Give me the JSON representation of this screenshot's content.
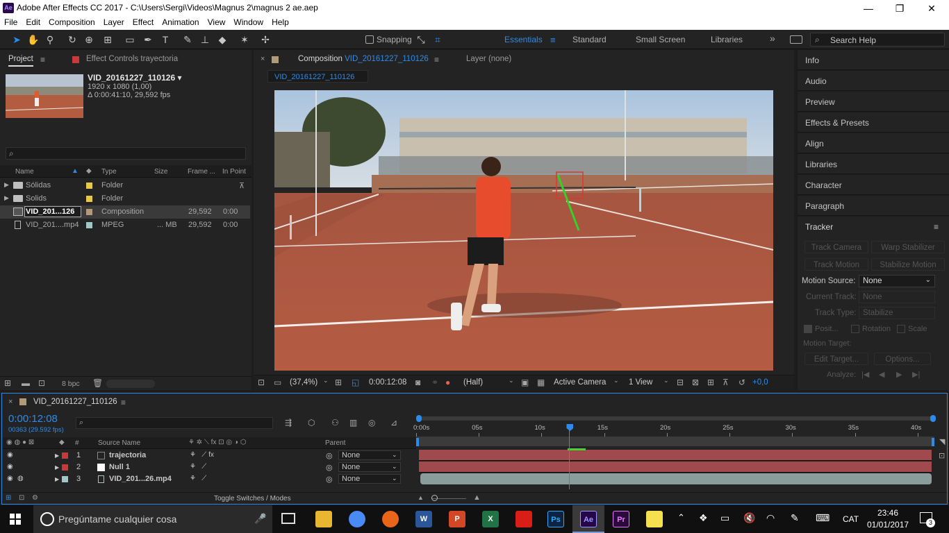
{
  "titlebar": {
    "app_icon": "Ae",
    "title": "Adobe After Effects CC 2017 - C:\\Users\\Sergi\\Videos\\Magnus 2\\magnus 2 ae.aep",
    "minimize": "—",
    "restore": "❐",
    "close": "✕"
  },
  "menu": [
    "File",
    "Edit",
    "Composition",
    "Layer",
    "Effect",
    "Animation",
    "View",
    "Window",
    "Help"
  ],
  "toolbar": {
    "snapping_label": "Snapping",
    "search_placeholder": "Search Help",
    "more": "»"
  },
  "workspaces": [
    "Essentials",
    "Standard",
    "Small Screen",
    "Libraries"
  ],
  "project_panel": {
    "tab_project": "Project",
    "tab_effect_controls": "Effect Controls trayectoria",
    "item_name": "VID_20161227_110126 ▾",
    "item_res": "1920 x 1080 (1,00)",
    "item_dur": "Δ 0:00:41:10, 29,592 fps",
    "search_placeholder": "",
    "columns": {
      "name": "Name",
      "type": "Type",
      "size": "Size",
      "frame": "Frame ...",
      "in_point": "In Point"
    },
    "rows": [
      {
        "name": "Sólidas",
        "type": "Folder",
        "size": "",
        "frame": "",
        "in_point": "",
        "color": "#e6c84a"
      },
      {
        "name": "Solids",
        "type": "Folder",
        "size": "",
        "frame": "",
        "in_point": "",
        "color": "#e6c84a"
      },
      {
        "name": "VID_201...126",
        "type": "Composition",
        "size": "",
        "frame": "29,592",
        "in_point": "0:00",
        "color": "#b09a78"
      },
      {
        "name": "VID_201....mp4",
        "type": "MPEG",
        "size": "... MB",
        "frame": "29,592",
        "in_point": "0:00",
        "color": "#9fc7c7"
      }
    ],
    "bpc": "8 bpc"
  },
  "composition": {
    "tab_prefix": "Composition",
    "tab_name": "VID_20161227_110126",
    "layer_tab": "Layer (none)",
    "subtab": "VID_20161227_110126",
    "zoom": "(37,4%)",
    "timecode": "0:00:12:08",
    "resolution": "(Half)",
    "camera": "Active Camera",
    "views": "1 View",
    "exposure": "+0,0"
  },
  "right_panels": [
    "Info",
    "Audio",
    "Preview",
    "Effects & Presets",
    "Align",
    "Libraries",
    "Character",
    "Paragraph"
  ],
  "tracker": {
    "title": "Tracker",
    "track_camera": "Track Camera",
    "warp_stabilizer": "Warp Stabilizer",
    "track_motion": "Track Motion",
    "stabilize_motion": "Stabilize Motion",
    "motion_source_label": "Motion Source:",
    "motion_source_value": "None",
    "current_track_label": "Current Track:",
    "current_track_value": "None",
    "track_type_label": "Track Type:",
    "track_type_value": "Stabilize",
    "position_label": "Posit...",
    "rotation_label": "Rotation",
    "scale_label": "Scale",
    "motion_target_label": "Motion Target:",
    "edit_target": "Edit Target...",
    "options": "Options...",
    "analyze_label": "Analyze:"
  },
  "timeline": {
    "comp_name": "VID_20161227_110126",
    "timecode": "0:00:12:08",
    "frame_info": "00363 (29.592 fps)",
    "search_placeholder": "",
    "col_num": "#",
    "col_source": "Source Name",
    "col_parent": "Parent",
    "layers": [
      {
        "num": "1",
        "name": "trajectoria_disp",
        "display": "trajectoria",
        "color": "#c83a3a",
        "parent": "None"
      },
      {
        "num": "2",
        "name": "null",
        "display": "Null 1",
        "color": "#c83a3a",
        "parent": "None"
      },
      {
        "num": "3",
        "name": "vid",
        "display": "VID_201...26.mp4",
        "color": "#9fc7c7",
        "parent": "None"
      }
    ],
    "ruler": [
      "0:00s",
      "05s",
      "10s",
      "15s",
      "20s",
      "25s",
      "30s",
      "35s",
      "40s"
    ],
    "playhead_seconds": 12.27,
    "total_seconds": 41.33,
    "toggle_label": "Toggle Switches / Modes"
  },
  "taskbar": {
    "search": "Pregúntame cualquier cosa",
    "lang": "CAT",
    "time": "23:46",
    "date": "01/01/2017",
    "notif_count": "3",
    "apps": [
      {
        "name": "explorer",
        "label": "",
        "color": "#e8b630"
      },
      {
        "name": "chrome",
        "label": "",
        "color": "#4a8af4"
      },
      {
        "name": "firefox",
        "label": "",
        "color": "#e8651a"
      },
      {
        "name": "word",
        "label": "W",
        "color": "#2b579a"
      },
      {
        "name": "powerpoint",
        "label": "P",
        "color": "#d24726"
      },
      {
        "name": "excel",
        "label": "X",
        "color": "#217346"
      },
      {
        "name": "creative-cloud",
        "label": "",
        "color": "#d91e18"
      },
      {
        "name": "photoshop",
        "label": "Ps",
        "color": "#0c2440"
      },
      {
        "name": "after-effects",
        "label": "Ae",
        "color": "#250845"
      },
      {
        "name": "premiere",
        "label": "Pr",
        "color": "#2a0a3a"
      },
      {
        "name": "sticky-notes",
        "label": "",
        "color": "#f5e050"
      }
    ]
  }
}
